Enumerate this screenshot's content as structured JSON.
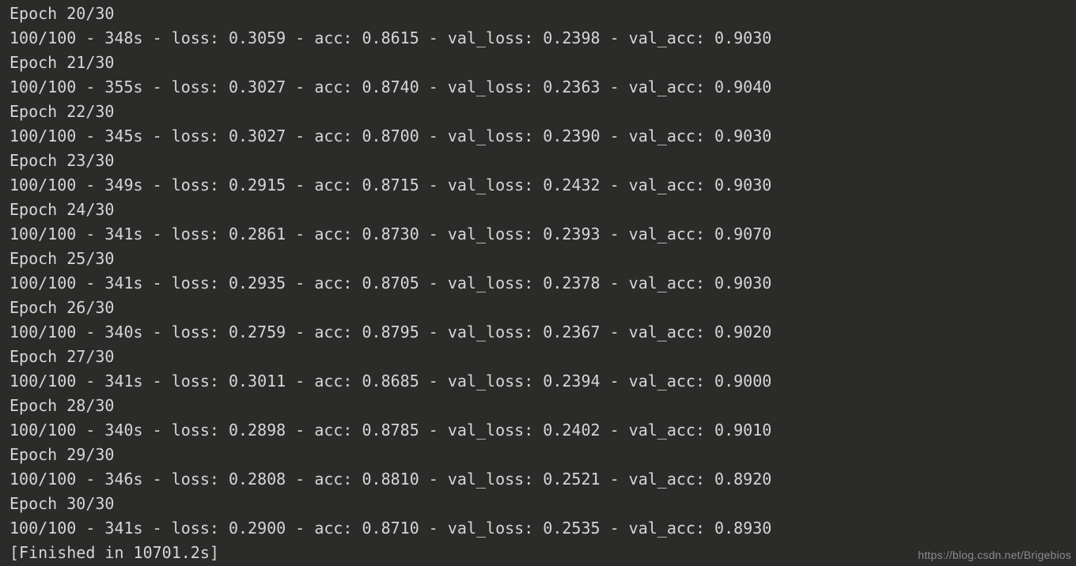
{
  "total_epochs": 30,
  "steps": "100/100",
  "epochs": [
    {
      "n": 20,
      "time": "348s",
      "loss": "0.3059",
      "acc": "0.8615",
      "val_loss": "0.2398",
      "val_acc": "0.9030"
    },
    {
      "n": 21,
      "time": "355s",
      "loss": "0.3027",
      "acc": "0.8740",
      "val_loss": "0.2363",
      "val_acc": "0.9040"
    },
    {
      "n": 22,
      "time": "345s",
      "loss": "0.3027",
      "acc": "0.8700",
      "val_loss": "0.2390",
      "val_acc": "0.9030"
    },
    {
      "n": 23,
      "time": "349s",
      "loss": "0.2915",
      "acc": "0.8715",
      "val_loss": "0.2432",
      "val_acc": "0.9030"
    },
    {
      "n": 24,
      "time": "341s",
      "loss": "0.2861",
      "acc": "0.8730",
      "val_loss": "0.2393",
      "val_acc": "0.9070"
    },
    {
      "n": 25,
      "time": "341s",
      "loss": "0.2935",
      "acc": "0.8705",
      "val_loss": "0.2378",
      "val_acc": "0.9030"
    },
    {
      "n": 26,
      "time": "340s",
      "loss": "0.2759",
      "acc": "0.8795",
      "val_loss": "0.2367",
      "val_acc": "0.9020"
    },
    {
      "n": 27,
      "time": "341s",
      "loss": "0.3011",
      "acc": "0.8685",
      "val_loss": "0.2394",
      "val_acc": "0.9000"
    },
    {
      "n": 28,
      "time": "340s",
      "loss": "0.2898",
      "acc": "0.8785",
      "val_loss": "0.2402",
      "val_acc": "0.9010"
    },
    {
      "n": 29,
      "time": "346s",
      "loss": "0.2808",
      "acc": "0.8810",
      "val_loss": "0.2521",
      "val_acc": "0.8920"
    },
    {
      "n": 30,
      "time": "341s",
      "loss": "0.2900",
      "acc": "0.8710",
      "val_loss": "0.2535",
      "val_acc": "0.8930"
    }
  ],
  "finished": "[Finished in 10701.2s]",
  "watermark": "https://blog.csdn.net/Brigebios"
}
